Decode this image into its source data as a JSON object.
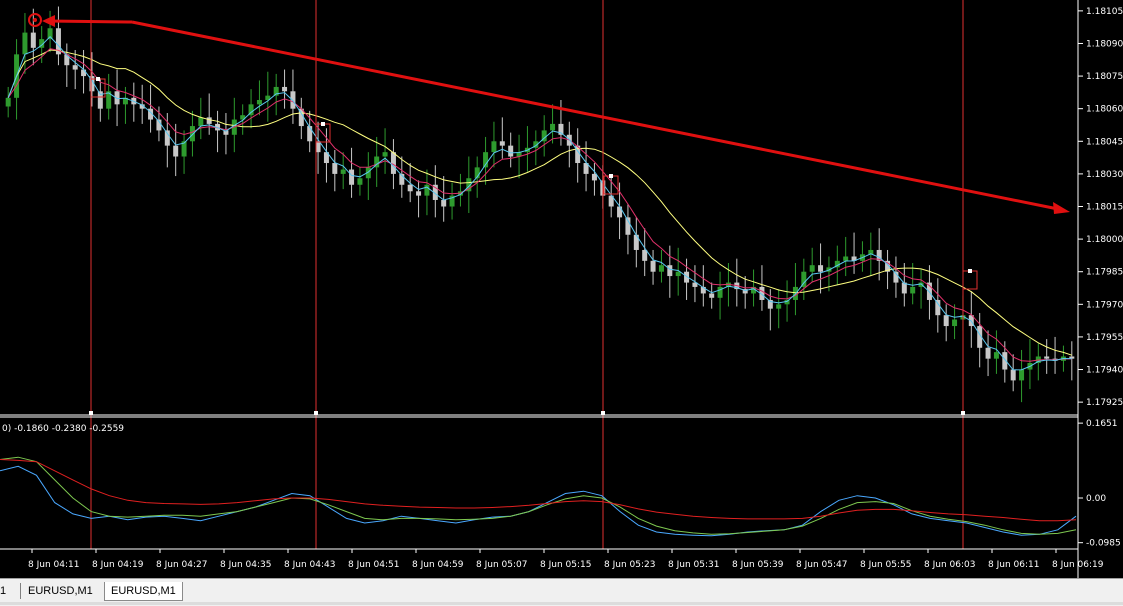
{
  "chart_data": [
    {
      "type": "candlestick",
      "symbol": "EURUSD,M1",
      "ylim": [
        1.1792,
        1.1811
      ],
      "y_ticks": [
        "1.18105",
        "1.18090",
        "1.18075",
        "1.18060",
        "1.18045",
        "1.18030",
        "1.18015",
        "1.18000",
        "1.17985",
        "1.17970",
        "1.17955",
        "1.17940",
        "1.17925"
      ],
      "x_ticks": [
        "8 Jun 04:11",
        "8 Jun 04:19",
        "8 Jun 04:27",
        "8 Jun 04:35",
        "8 Jun 04:43",
        "8 Jun 04:51",
        "8 Jun 04:59",
        "8 Jun 05:07",
        "8 Jun 05:15",
        "8 Jun 05:23",
        "8 Jun 05:31",
        "8 Jun 05:39",
        "8 Jun 05:47",
        "8 Jun 05:55",
        "8 Jun 06:03",
        "8 Jun 06:11",
        "8 Jun 06:19"
      ],
      "close": [
        1.18065,
        1.18085,
        1.18095,
        1.18088,
        1.18092,
        1.18097,
        1.18085,
        1.1808,
        1.18078,
        1.18075,
        1.18068,
        1.1806,
        1.18068,
        1.18062,
        1.18065,
        1.18062,
        1.1806,
        1.18055,
        1.1805,
        1.18043,
        1.18038,
        1.18045,
        1.18052,
        1.18056,
        1.18053,
        1.1805,
        1.18048,
        1.18055,
        1.18057,
        1.18062,
        1.18064,
        1.18066,
        1.1807,
        1.18068,
        1.1806,
        1.18052,
        1.18045,
        1.1804,
        1.18035,
        1.1803,
        1.18032,
        1.18025,
        1.18028,
        1.18033,
        1.18038,
        1.1804,
        1.1803,
        1.18025,
        1.18022,
        1.1802,
        1.18025,
        1.18018,
        1.18015,
        1.1802,
        1.18022,
        1.18028,
        1.18033,
        1.1804,
        1.18045,
        1.18043,
        1.18038,
        1.1804,
        1.18042,
        1.18045,
        1.1805,
        1.18053,
        1.18048,
        1.18043,
        1.18035,
        1.1803,
        1.18027,
        1.1802,
        1.18015,
        1.1801,
        1.18002,
        1.17995,
        1.1799,
        1.17985,
        1.17988,
        1.17983,
        1.17985,
        1.1798,
        1.17978,
        1.17975,
        1.17973,
        1.17978,
        1.1798,
        1.17977,
        1.17975,
        1.17978,
        1.17972,
        1.17968,
        1.1797,
        1.17972,
        1.17978,
        1.17985,
        1.17988,
        1.17985,
        1.17987,
        1.1799,
        1.17992,
        1.1799,
        1.17993,
        1.17995,
        1.1799,
        1.17985,
        1.1798,
        1.17975,
        1.17978,
        1.1798,
        1.17972,
        1.17965,
        1.1796,
        1.17963,
        1.17965,
        1.1796,
        1.1795,
        1.17945,
        1.17948,
        1.1794,
        1.17935,
        1.1794,
        1.17943,
        1.17946,
        1.17945,
        1.17944,
        1.17946,
        1.17945
      ],
      "ema_fast_color": "#5bc8f0",
      "ema_mid_color": "#e0306a",
      "sma_slow_color": "#ffff80",
      "bull_color": "#2e9b2e",
      "bear_color": "#c8c8c8",
      "vline_color": "#e03030",
      "arrow_color": "#e01010",
      "current_price": "1.17940"
    },
    {
      "type": "line",
      "header": "0) -0.1860 -0.2380 -0.2559",
      "ylim": [
        -0.108,
        0.172
      ],
      "y_ticks": [
        "0.1651",
        "0.00",
        "-0.0985"
      ],
      "series": [
        {
          "color": "#4aa8ff",
          "values": [
            0.06,
            0.07,
            0.05,
            -0.01,
            -0.035,
            -0.045,
            -0.04,
            -0.048,
            -0.042,
            -0.04,
            -0.045,
            -0.05,
            -0.04,
            -0.03,
            -0.02,
            -0.005,
            0.01,
            0.005,
            -0.02,
            -0.045,
            -0.055,
            -0.05,
            -0.04,
            -0.045,
            -0.05,
            -0.055,
            -0.048,
            -0.042,
            -0.04,
            -0.03,
            -0.01,
            0.01,
            0.015,
            0.005,
            -0.03,
            -0.06,
            -0.075,
            -0.08,
            -0.082,
            -0.083,
            -0.08,
            -0.075,
            -0.072,
            -0.07,
            -0.06,
            -0.03,
            -0.005,
            0.005,
            0.0,
            -0.015,
            -0.035,
            -0.045,
            -0.05,
            -0.055,
            -0.065,
            -0.075,
            -0.082,
            -0.08,
            -0.07,
            -0.04
          ]
        },
        {
          "color": "#7ec850",
          "values": [
            0.085,
            0.09,
            0.08,
            0.04,
            0.0,
            -0.03,
            -0.04,
            -0.042,
            -0.04,
            -0.038,
            -0.038,
            -0.04,
            -0.035,
            -0.03,
            -0.02,
            -0.01,
            0.0,
            -0.002,
            -0.015,
            -0.03,
            -0.045,
            -0.048,
            -0.045,
            -0.045,
            -0.046,
            -0.048,
            -0.047,
            -0.045,
            -0.04,
            -0.03,
            -0.015,
            -0.002,
            0.005,
            0.0,
            -0.02,
            -0.045,
            -0.062,
            -0.072,
            -0.077,
            -0.08,
            -0.079,
            -0.076,
            -0.073,
            -0.07,
            -0.062,
            -0.045,
            -0.025,
            -0.01,
            -0.008,
            -0.012,
            -0.028,
            -0.04,
            -0.047,
            -0.052,
            -0.06,
            -0.07,
            -0.078,
            -0.08,
            -0.078,
            -0.07
          ]
        },
        {
          "color": "#e02020",
          "values": [
            0.085,
            0.083,
            0.08,
            0.06,
            0.04,
            0.02,
            0.005,
            -0.005,
            -0.01,
            -0.012,
            -0.013,
            -0.014,
            -0.013,
            -0.01,
            -0.006,
            -0.002,
            0.0,
            0.0,
            -0.003,
            -0.008,
            -0.013,
            -0.016,
            -0.018,
            -0.02,
            -0.021,
            -0.022,
            -0.022,
            -0.021,
            -0.019,
            -0.016,
            -0.012,
            -0.008,
            -0.006,
            -0.008,
            -0.015,
            -0.024,
            -0.031,
            -0.036,
            -0.04,
            -0.043,
            -0.045,
            -0.046,
            -0.046,
            -0.046,
            -0.045,
            -0.04,
            -0.033,
            -0.027,
            -0.025,
            -0.025,
            -0.028,
            -0.032,
            -0.035,
            -0.037,
            -0.04,
            -0.043,
            -0.047,
            -0.05,
            -0.05,
            -0.048
          ]
        }
      ]
    }
  ],
  "tabs": [
    "1",
    "EURUSD,M1",
    "EURUSD,M1"
  ]
}
